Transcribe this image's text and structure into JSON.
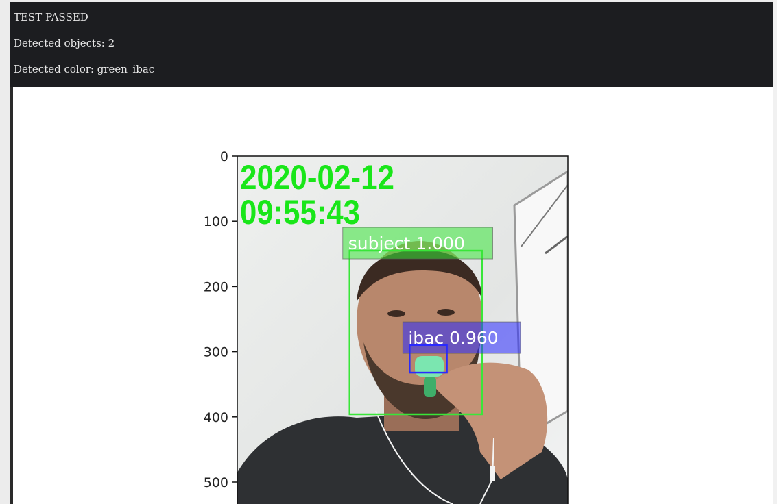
{
  "status": {
    "result": "TEST PASSED",
    "objects_line": "Detected objects: 2",
    "color_line": "Detected color: green_ibac"
  },
  "chart_data": {
    "type": "image",
    "y_ticks": [
      0,
      100,
      200,
      300,
      400,
      500
    ],
    "timestamp": {
      "date": "2020-02-12",
      "time": "09:55:43",
      "color": "#19e619"
    },
    "detections": [
      {
        "label": "subject",
        "score": "1.000",
        "text": "subject 1.000",
        "color": "#39e639",
        "box": {
          "x0": 172,
          "y0": 145,
          "x1": 375,
          "y1": 396
        }
      },
      {
        "label": "ibac",
        "score": "0.960",
        "text": "ibac 0.960",
        "color": "#2a2aff",
        "box": {
          "x0": 264,
          "y0": 290,
          "x1": 321,
          "y1": 332
        }
      }
    ]
  }
}
